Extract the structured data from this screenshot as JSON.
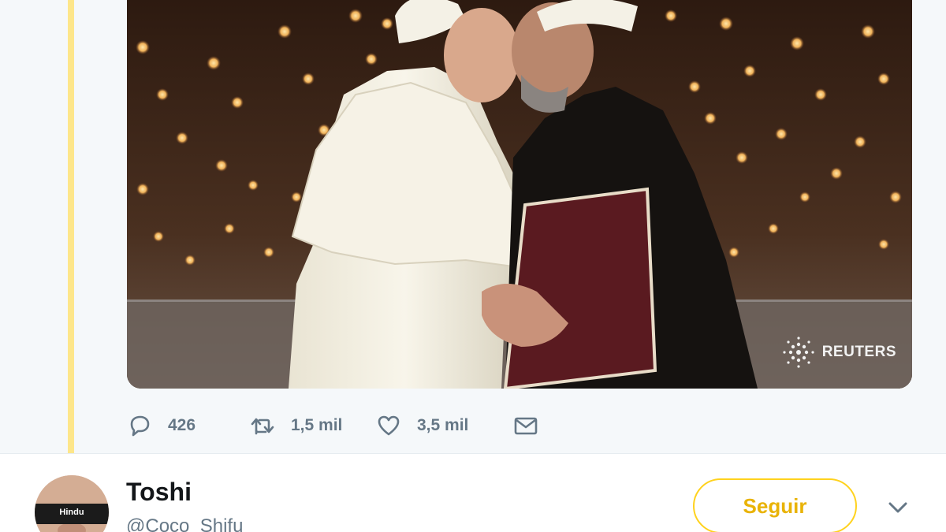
{
  "media": {
    "watermark_text": "REUTERS"
  },
  "actions": {
    "reply": {
      "icon": "reply-icon",
      "count": "426"
    },
    "retweet": {
      "icon": "retweet-icon",
      "count": "1,5 mil"
    },
    "like": {
      "icon": "heart-icon",
      "count": "3,5 mil"
    },
    "message": {
      "icon": "envelope-icon"
    }
  },
  "next_tweet": {
    "display_name": "Toshi",
    "screen_name": "@Coco_Shifu",
    "avatar_band_text": "Hindu",
    "follow_label": "Seguir",
    "menu_icon": "chevron-down-icon"
  },
  "colors": {
    "thread_line": "#fde68a",
    "follow_accent": "#e9b307",
    "muted_text": "#657786"
  }
}
